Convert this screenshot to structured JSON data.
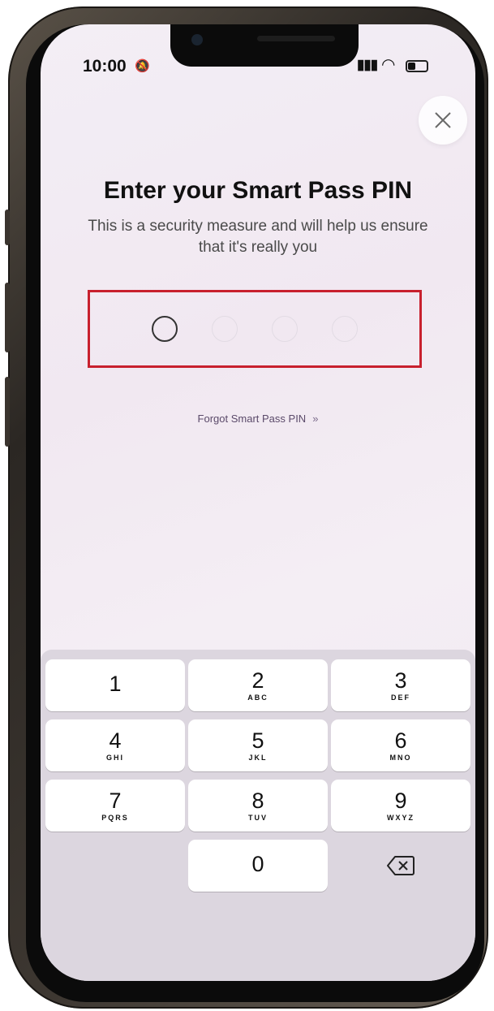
{
  "status_bar": {
    "time": "10:00",
    "signal_icon": "signal-bars-icon",
    "wifi_icon": "wifi-icon",
    "battery_icon": "battery-icon"
  },
  "header": {
    "title": "Enter your Smart Pass PIN",
    "subtitle": "This is a security measure and will help us ensure that it's really you"
  },
  "pin": {
    "length": 4,
    "entered": 0,
    "highlight_color": "#c8202e"
  },
  "forgot_link": {
    "label": "Forgot Smart Pass PIN",
    "chevron": "»"
  },
  "keypad": {
    "keys": [
      {
        "num": "1",
        "letters": ""
      },
      {
        "num": "2",
        "letters": "ABC"
      },
      {
        "num": "3",
        "letters": "DEF"
      },
      {
        "num": "4",
        "letters": "GHI"
      },
      {
        "num": "5",
        "letters": "JKL"
      },
      {
        "num": "6",
        "letters": "MNO"
      },
      {
        "num": "7",
        "letters": "PQRS"
      },
      {
        "num": "8",
        "letters": "TUV"
      },
      {
        "num": "9",
        "letters": "WXYZ"
      },
      {
        "num": "0",
        "letters": ""
      }
    ],
    "delete_icon": "backspace-icon"
  },
  "colors": {
    "accent": "#c8202e",
    "keypad_bg": "#dcd6df",
    "screen_bg": "#f3eef5"
  }
}
